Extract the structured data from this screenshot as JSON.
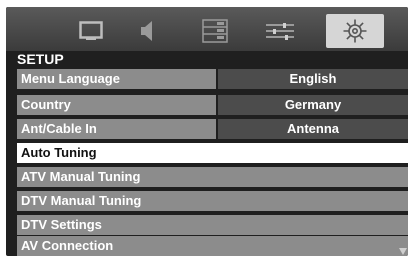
{
  "icons": {
    "picture": "picture-icon",
    "sound": "sound-icon",
    "features": "features-icon",
    "preferences": "preferences-icon",
    "setup": "gear-icon",
    "scroll": "scroll-down-arrow-icon"
  },
  "section_title": "SETUP",
  "menu": {
    "menu_language": {
      "label": "Menu Language",
      "value": "English"
    },
    "country": {
      "label": "Country",
      "value": "Germany"
    },
    "ant_cable": {
      "label": "Ant/Cable In",
      "value": "Antenna"
    },
    "auto_tuning": {
      "label": "Auto Tuning"
    },
    "atv_manual": {
      "label": "ATV Manual Tuning"
    },
    "dtv_manual": {
      "label": "DTV Manual Tuning"
    },
    "dtv_settings": {
      "label": "DTV Settings"
    },
    "av_connection": {
      "label": "AV Connection"
    }
  },
  "colors": {
    "background": "#1f1f1f",
    "row_label": "#8c8c8c",
    "row_value": "#4c4c4c",
    "highlight": "#ffffff",
    "selected_tab": "#d6d6d6"
  }
}
